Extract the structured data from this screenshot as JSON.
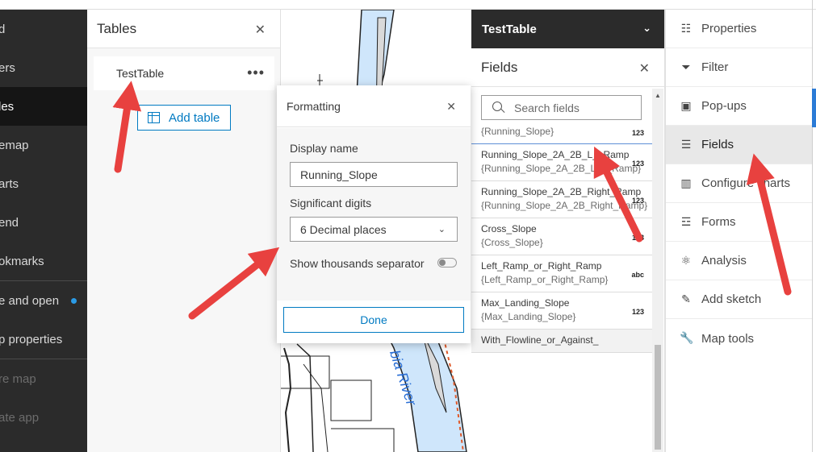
{
  "colors": {
    "accent": "#007ac2",
    "arrow": "#e8413f",
    "nav_bg": "#2b2b2b",
    "river": "#cfe6fb"
  },
  "leftnav": {
    "items": [
      {
        "label": "d",
        "state": "normal"
      },
      {
        "label": "ers",
        "state": "normal"
      },
      {
        "label": "les",
        "state": "active"
      },
      {
        "label": "emap",
        "state": "normal"
      },
      {
        "label": "arts",
        "state": "normal"
      },
      {
        "label": "end",
        "state": "normal"
      },
      {
        "label": "okmarks",
        "state": "normal"
      },
      {
        "label": "e and open",
        "state": "normal"
      },
      {
        "label": "p properties",
        "state": "normal"
      },
      {
        "label": "re map",
        "state": "dim"
      },
      {
        "label": "ate app",
        "state": "dim"
      }
    ]
  },
  "tables_panel": {
    "title": "Tables",
    "close_icon": "close-icon",
    "row_label": "TestTable",
    "more_icon": "ellipsis-icon",
    "add_label": "Add table"
  },
  "map": {
    "river_label": "bia River"
  },
  "fields_panel": {
    "layer_name": "TestTable",
    "title": "Fields",
    "search_placeholder": "Search fields",
    "items": [
      {
        "name": "",
        "alias": "{Running_Slope}",
        "type": "123"
      },
      {
        "name": "Running_Slope_2A_2B_L__Ramp",
        "alias": "{Running_Slope_2A_2B_Left_Ramp}",
        "type": "123"
      },
      {
        "name": "Running_Slope_2A_2B_Right_Ramp",
        "alias": "{Running_Slope_2A_2B_Right_Ramp}",
        "type": "123"
      },
      {
        "name": "Cross_Slope",
        "alias": "{Cross_Slope}",
        "type": "123"
      },
      {
        "name": "Left_Ramp_or_Right_Ramp",
        "alias": "{Left_Ramp_or_Right_Ramp}",
        "type": "abc"
      },
      {
        "name": "Max_Landing_Slope",
        "alias": "{Max_Landing_Slope}",
        "type": "123"
      },
      {
        "name": "With_Flowline_or_Against_",
        "alias": "",
        "type": ""
      }
    ]
  },
  "formatting": {
    "title": "Formatting",
    "display_name_label": "Display name",
    "display_name_value": "Running_Slope",
    "sig_digits_label": "Significant digits",
    "sig_digits_value": "6 Decimal places",
    "thousands_label": "Show thousands separator",
    "thousands_on": false,
    "done_label": "Done"
  },
  "settings_panel": {
    "items": [
      {
        "label": "Properties",
        "icon": "sliders-icon"
      },
      {
        "label": "Filter",
        "icon": "filter-icon"
      },
      {
        "label": "Pop-ups",
        "icon": "popup-icon"
      },
      {
        "label": "Fields",
        "icon": "fields-list-icon",
        "active": true
      },
      {
        "label": "Configure charts",
        "icon": "chart-icon"
      },
      {
        "label": "Forms",
        "icon": "form-icon"
      },
      {
        "label": "Analysis",
        "icon": "analysis-icon"
      },
      {
        "label": "Add sketch",
        "icon": "sketch-icon"
      },
      {
        "label": "Map tools",
        "icon": "wrench-icon"
      }
    ]
  }
}
